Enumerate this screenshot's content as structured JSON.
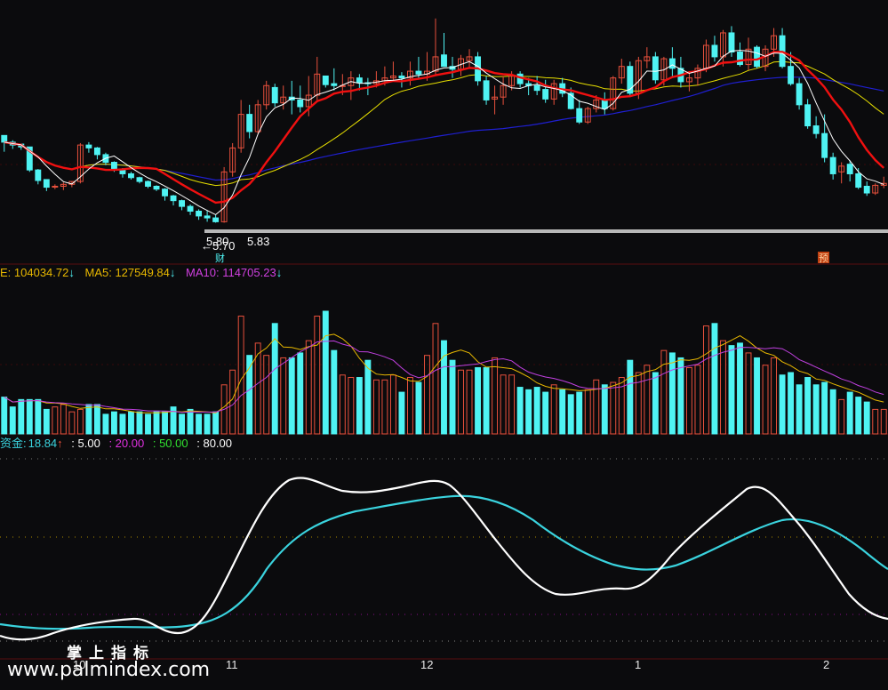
{
  "colors": {
    "background": "#0b0b0d",
    "up": "#e8503c",
    "down": "#4ff3f3",
    "ma_fast": "#ffffff",
    "ma_mid": "#f01010",
    "ma_slow": "#e8e000",
    "ma_long": "#1f1fd0",
    "vol_ma5": "#e8b800",
    "vol_ma10": "#c040e0",
    "osc_white": "#ffffff",
    "osc_cyan": "#3ad3de",
    "grid": "#5a0e0e"
  },
  "price_panel": {
    "low_label": "5.80",
    "low_label_2": "5.83",
    "low_marker_label": "5.70",
    "finance_tag": "财",
    "forecast_tag": "预"
  },
  "volume_panel": {
    "vol_label": "E: 104034.72",
    "ma5_label": "MA5: 127549.84",
    "ma10_label": "MA10: 114705.23",
    "arrow": "↓"
  },
  "osc_panel": {
    "name_label": "资金:",
    "name_value": "18.84",
    "name_arrow": "↑",
    "level1": ": 5.00",
    "level2": ": 20.00",
    "level3": ": 50.00",
    "level4": ": 80.00",
    "colors": [
      "#3ad3de",
      "#ffffff",
      "#e030e0",
      "#30e030",
      "#ffffff"
    ]
  },
  "x_axis": {
    "ticks": [
      "10",
      "11",
      "12",
      "1",
      "2"
    ]
  },
  "watermark": {
    "url": "www.palmindex.com",
    "title": "掌上指标"
  },
  "chart_data": {
    "type": "candlestick",
    "series": [
      {
        "name": "OHLC",
        "values": [
          [
            58,
            58,
            41,
            51
          ],
          [
            51,
            53,
            44,
            48
          ],
          [
            49,
            49,
            43,
            46
          ],
          [
            46,
            46,
            20,
            22
          ],
          [
            22,
            23,
            7,
            11
          ],
          [
            12,
            12,
            0,
            4
          ],
          [
            5,
            7,
            2,
            5
          ],
          [
            5,
            9,
            1,
            7
          ],
          [
            7,
            10,
            4,
            10
          ],
          [
            10,
            50,
            8,
            48
          ],
          [
            48,
            51,
            40,
            45
          ],
          [
            45,
            46,
            33,
            38
          ],
          [
            38,
            40,
            27,
            30
          ],
          [
            30,
            31,
            20,
            22
          ],
          [
            22,
            24,
            14,
            18
          ],
          [
            18,
            20,
            12,
            14
          ],
          [
            14,
            15,
            8,
            10
          ],
          [
            10,
            11,
            3,
            5
          ],
          [
            5,
            6,
            0,
            2
          ],
          [
            2,
            3,
            -10,
            -5
          ],
          [
            -5,
            -4,
            -15,
            -10
          ],
          [
            -10,
            -9,
            -20,
            -16
          ],
          [
            -16,
            -14,
            -25,
            -21
          ],
          [
            -21,
            -19,
            -30,
            -26
          ],
          [
            -26,
            -20,
            -32,
            -28
          ],
          [
            -28,
            -25,
            -33,
            -32
          ],
          [
            -32,
            25,
            -33,
            20
          ],
          [
            20,
            50,
            15,
            45
          ],
          [
            45,
            95,
            40,
            80
          ],
          [
            80,
            90,
            55,
            62
          ],
          [
            62,
            95,
            60,
            90
          ],
          [
            90,
            115,
            85,
            110
          ],
          [
            108,
            112,
            88,
            92
          ],
          [
            92,
            110,
            85,
            98
          ],
          [
            98,
            115,
            80,
            95
          ],
          [
            95,
            110,
            82,
            88
          ],
          [
            88,
            120,
            78,
            100
          ],
          [
            100,
            140,
            95,
            122
          ],
          [
            120,
            120,
            108,
            111
          ],
          [
            112,
            128,
            105,
            110
          ],
          [
            110,
            122,
            100,
            110
          ],
          [
            110,
            125,
            95,
            118
          ],
          [
            118,
            122,
            105,
            113
          ],
          [
            113,
            118,
            100,
            112
          ],
          [
            112,
            125,
            108,
            115
          ],
          [
            115,
            130,
            110,
            118
          ],
          [
            118,
            135,
            115,
            120
          ],
          [
            120,
            124,
            108,
            118
          ],
          [
            118,
            135,
            110,
            125
          ],
          [
            125,
            140,
            118,
            122
          ],
          [
            122,
            145,
            115,
            125
          ],
          [
            125,
            180,
            120,
            140
          ],
          [
            142,
            165,
            130,
            130
          ],
          [
            130,
            140,
            118,
            127
          ],
          [
            127,
            142,
            120,
            138
          ],
          [
            136,
            148,
            128,
            140
          ],
          [
            140,
            145,
            110,
            115
          ],
          [
            115,
            120,
            90,
            95
          ],
          [
            96,
            110,
            80,
            98
          ],
          [
            98,
            120,
            90,
            110
          ],
          [
            110,
            125,
            105,
            120
          ],
          [
            122,
            125,
            108,
            112
          ],
          [
            112,
            118,
            100,
            110
          ],
          [
            110,
            120,
            100,
            105
          ],
          [
            106,
            116,
            92,
            96
          ],
          [
            96,
            116,
            90,
            112
          ],
          [
            112,
            118,
            98,
            102
          ],
          [
            102,
            108,
            85,
            86
          ],
          [
            86,
            95,
            70,
            72
          ],
          [
            72,
            88,
            70,
            86
          ],
          [
            86,
            100,
            82,
            95
          ],
          [
            95,
            103,
            80,
            86
          ],
          [
            86,
            120,
            84,
            118
          ],
          [
            118,
            138,
            112,
            130
          ],
          [
            130,
            135,
            98,
            102
          ],
          [
            102,
            140,
            96,
            136
          ],
          [
            136,
            150,
            128,
            140
          ],
          [
            140,
            145,
            112,
            116
          ],
          [
            116,
            140,
            110,
            138
          ],
          [
            138,
            150,
            120,
            128
          ],
          [
            128,
            140,
            108,
            114
          ],
          [
            114,
            125,
            104,
            118
          ],
          [
            118,
            132,
            110,
            128
          ],
          [
            128,
            158,
            124,
            152
          ],
          [
            152,
            162,
            135,
            140
          ],
          [
            140,
            168,
            130,
            165
          ],
          [
            165,
            172,
            140,
            145
          ],
          [
            145,
            155,
            130,
            132
          ],
          [
            132,
            160,
            126,
            148
          ],
          [
            150,
            152,
            128,
            130
          ],
          [
            130,
            152,
            125,
            148
          ],
          [
            148,
            170,
            140,
            162
          ],
          [
            162,
            170,
            128,
            130
          ],
          [
            130,
            145,
            110,
            112
          ],
          [
            112,
            118,
            85,
            90
          ],
          [
            90,
            96,
            65,
            68
          ],
          [
            68,
            78,
            55,
            60
          ],
          [
            60,
            80,
            30,
            35
          ],
          [
            35,
            40,
            12,
            18
          ],
          [
            20,
            30,
            8,
            26
          ],
          [
            28,
            32,
            10,
            18
          ],
          [
            18,
            24,
            2,
            4
          ],
          [
            5,
            10,
            -5,
            -2
          ],
          [
            -2,
            8,
            -4,
            6
          ],
          [
            6,
            15,
            3,
            8
          ]
        ]
      },
      {
        "name": "VOL",
        "values": [
          15,
          11,
          14,
          14,
          14,
          10,
          11,
          12,
          9,
          10,
          12,
          12,
          8,
          9,
          8,
          9,
          9,
          8,
          9,
          9,
          11,
          8,
          10,
          8,
          8,
          9,
          20,
          26,
          48,
          32,
          37,
          32,
          45,
          31,
          31,
          33,
          38,
          48,
          50,
          34,
          24,
          23,
          23,
          30,
          22,
          22,
          24,
          17,
          23,
          21,
          32,
          45,
          38,
          30,
          26,
          26,
          27,
          27,
          31,
          24,
          24,
          19,
          18,
          19,
          17,
          20,
          18,
          16,
          17,
          18,
          22,
          20,
          21,
          23,
          30,
          25,
          28,
          25,
          34,
          33,
          31,
          27,
          28,
          44,
          45,
          38,
          36,
          37,
          33,
          31,
          28,
          31,
          24,
          25,
          20,
          23,
          20,
          21,
          18,
          14,
          17,
          15,
          13,
          10,
          10
        ]
      },
      {
        "name": "资金",
        "values": [
          null
        ]
      }
    ]
  }
}
